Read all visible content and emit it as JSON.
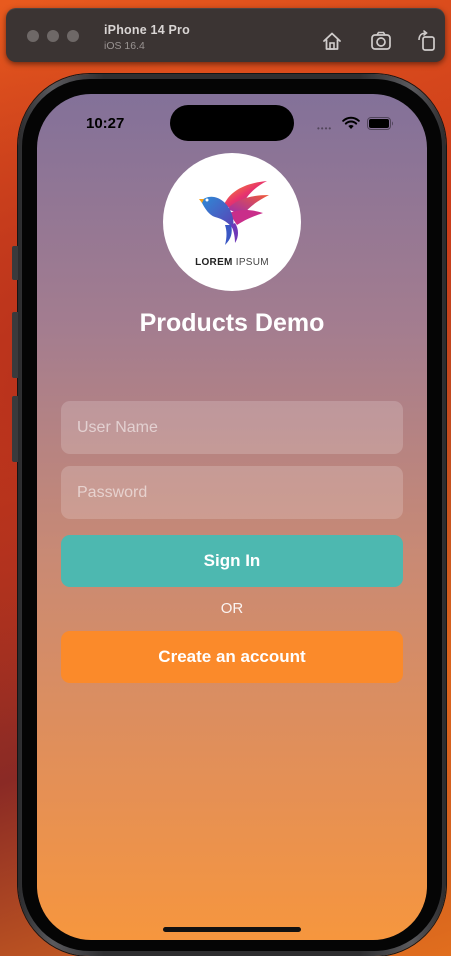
{
  "simulator": {
    "device_name": "iPhone 14 Pro",
    "os_version": "iOS 16.4",
    "toolbar_icons": [
      "home-icon",
      "screenshot-icon",
      "rotate-icon"
    ]
  },
  "status_bar": {
    "time": "10:27",
    "icons": [
      "signal-icon",
      "wifi-icon",
      "battery-icon"
    ]
  },
  "logo": {
    "text_bold": "LOREM",
    "text_light": " IPSUM"
  },
  "app": {
    "title": "Products Demo"
  },
  "form": {
    "username_placeholder": "User Name",
    "password_placeholder": "Password",
    "signin_label": "Sign In",
    "or_label": "OR",
    "create_account_label": "Create an account"
  },
  "colors": {
    "signin_button": "#4db8b0",
    "create_button": "#fb8a2a",
    "gradient_top": "#837199",
    "gradient_bottom": "#f6963e"
  }
}
